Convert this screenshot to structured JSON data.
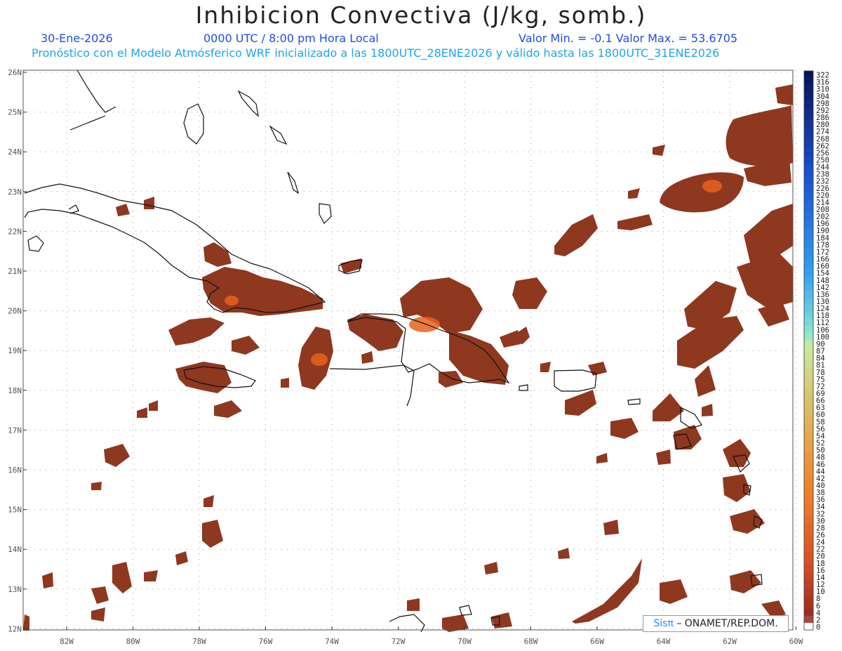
{
  "header": {
    "title": "Inhibicion Convectiva (J/kg, somb.)",
    "date": "30-Ene-2026",
    "time": "0000 UTC / 8:00 pm Hora Local",
    "range": "Valor Min. = -0.1  Valor Max. = 53.6705",
    "model": "Pronóstico con el Modelo Atmósferico WRF inicializado a las 1800UTC_28ENE2026 y válido hasta las  1800UTC_31ENE2026"
  },
  "axes": {
    "lat_labels": [
      "26N",
      "25N",
      "24N",
      "23N",
      "22N",
      "21N",
      "20N",
      "19N",
      "18N",
      "17N",
      "16N",
      "15N",
      "14N",
      "13N",
      "12N"
    ],
    "lon_labels": [
      "82W",
      "80W",
      "78W",
      "76W",
      "74W",
      "72W",
      "70W",
      "68W",
      "66W",
      "64W",
      "62W",
      "60W"
    ]
  },
  "colorbar": {
    "labels": [
      "322",
      "316",
      "310",
      "304",
      "298",
      "292",
      "286",
      "280",
      "274",
      "268",
      "262",
      "256",
      "250",
      "244",
      "238",
      "232",
      "226",
      "220",
      "214",
      "208",
      "202",
      "196",
      "190",
      "184",
      "178",
      "172",
      "166",
      "160",
      "154",
      "148",
      "142",
      "136",
      "130",
      "124",
      "118",
      "112",
      "106",
      "100",
      "90",
      "87",
      "84",
      "81",
      "78",
      "75",
      "72",
      "69",
      "66",
      "63",
      "60",
      "58",
      "56",
      "54",
      "52",
      "50",
      "48",
      "46",
      "44",
      "42",
      "40",
      "38",
      "36",
      "34",
      "32",
      "30",
      "28",
      "26",
      "24",
      "22",
      "20",
      "18",
      "16",
      "14",
      "12",
      "10",
      "8",
      "6",
      "4",
      "2",
      "0"
    ]
  },
  "colors": {
    "field_main": "#8e3820",
    "field_hot": "#e8621c",
    "coast": "#111111",
    "grid": "#9a9a9a"
  },
  "credit": {
    "brand": "Sisπ",
    "text": "– ONAMET/REP.DOM."
  }
}
